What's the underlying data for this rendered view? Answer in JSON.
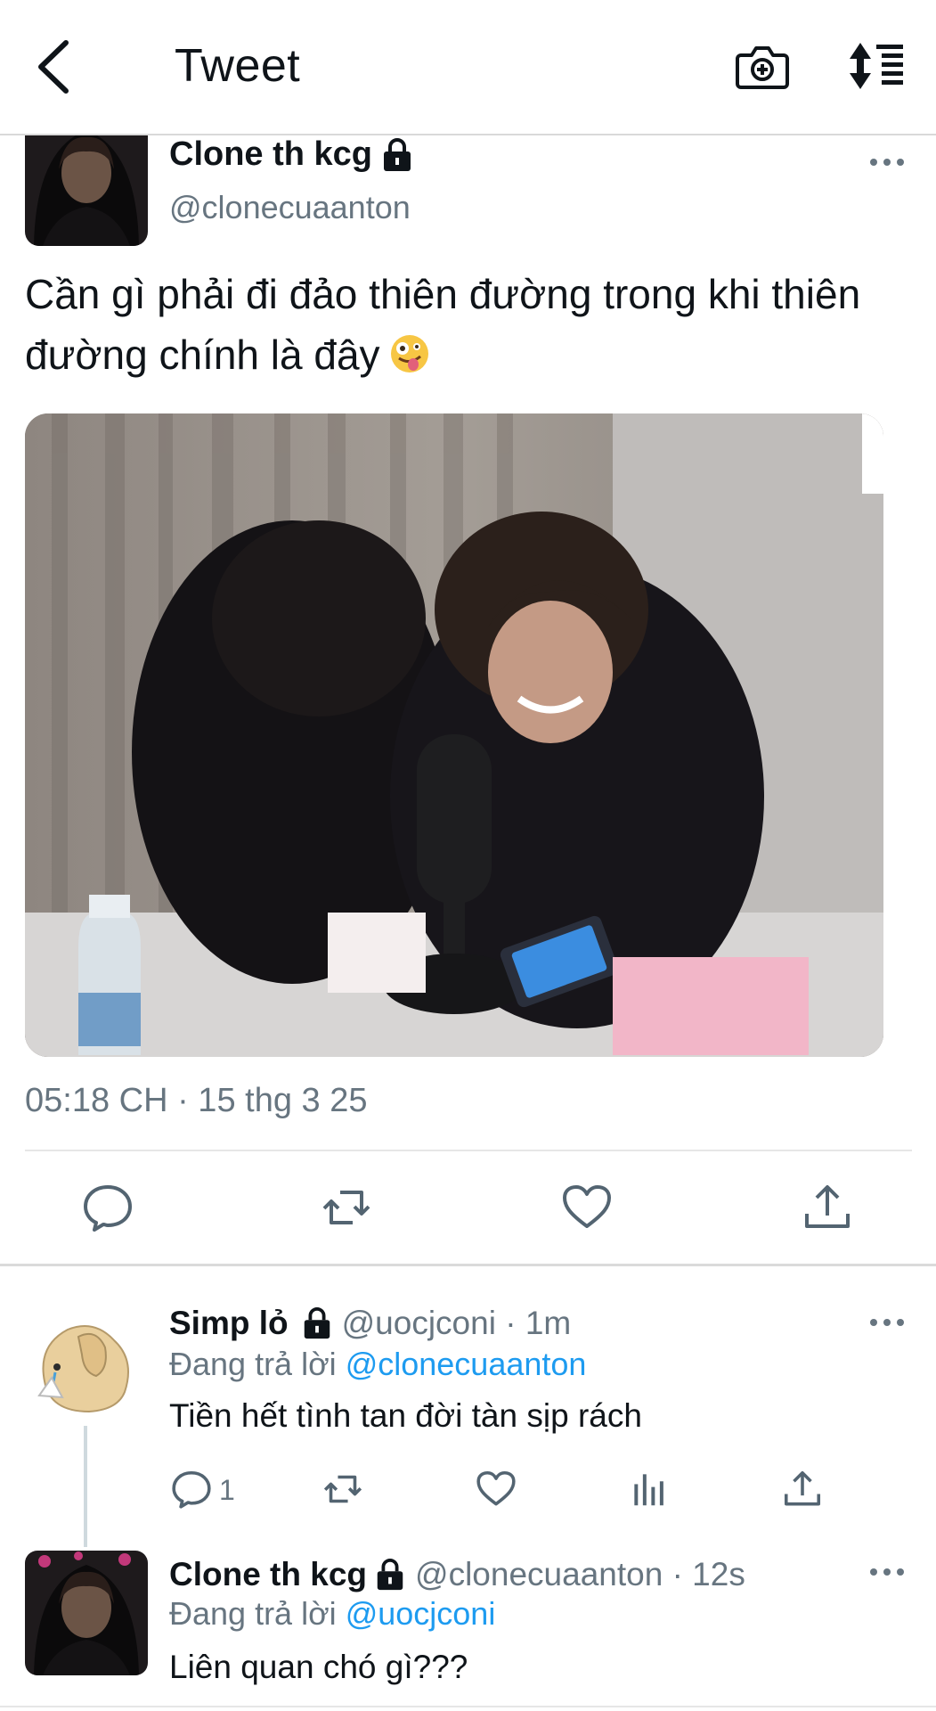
{
  "header": {
    "title": "Tweet",
    "back_icon": "chevron-left-icon",
    "camera_icon": "camera-plus-icon",
    "sort_icon": "sort-list-icon"
  },
  "tweet": {
    "display_name": "Clone th kcg",
    "handle": "@clonecuaanton",
    "text": "Cần gì phải đi đảo thiên đường trong khi thiên đường chính là đây",
    "emoji": "zany-face-emoji",
    "timestamp": "05:18 CH · 15 thg 3 25",
    "actions": [
      "reply-icon",
      "retweet-icon",
      "like-icon",
      "share-icon"
    ]
  },
  "replies": [
    {
      "display_name": "Simp lỏ",
      "meta": "@uocjconi · 1m",
      "replying_prefix": "Đang trả lời",
      "replying_to": "@clonecuaanton",
      "text": "Tiền hết tình tan đời tàn sịp rách",
      "reply_count": "1"
    },
    {
      "display_name": "Clone th kcg",
      "meta": "@clonecuaanton · 12s",
      "replying_prefix": "Đang trả lời",
      "replying_to": "@uocjconi",
      "text": "Liên quan chó gì???"
    }
  ],
  "colors": {
    "text": "#0f1419",
    "secondary": "#677580",
    "link": "#1d9bf0",
    "divider": "#e6e6e6"
  }
}
